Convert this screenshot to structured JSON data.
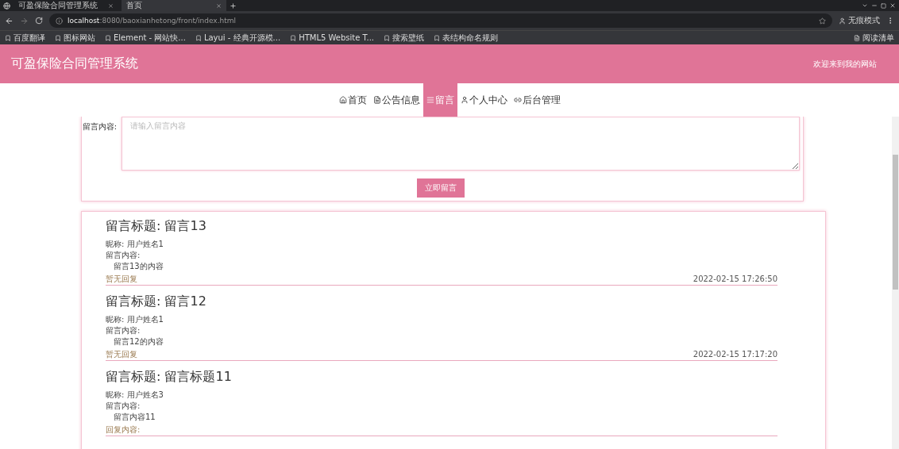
{
  "browser": {
    "tabs": [
      {
        "title": "可盈保险合同管理系统",
        "selected": false
      },
      {
        "title": "首页",
        "selected": true
      }
    ],
    "url_host": "localhost",
    "url_rest": ":8080/baoxianhetong/front/index.html",
    "profile": "无痕模式",
    "bookmarks": [
      "百度翻译",
      "图标网站",
      "Element - 网站快...",
      "Layui - 经典开源模...",
      "HTML5 Website T...",
      "搜索壁纸",
      "表结构命名规则"
    ],
    "reading_list": "阅读清单"
  },
  "header": {
    "title": "可盈保险合同管理系统",
    "welcome": "欢迎来到我的网站"
  },
  "nav": [
    {
      "label": "首页",
      "selected": false
    },
    {
      "label": "公告信息",
      "selected": false
    },
    {
      "label": "留言",
      "selected": true
    },
    {
      "label": "个人中心",
      "selected": false
    },
    {
      "label": "后台管理",
      "selected": false
    }
  ],
  "form": {
    "label": "留言内容:",
    "placeholder": "请输入留言内容",
    "submit": "立即留言"
  },
  "messages": [
    {
      "title_label": "留言标题:",
      "title": "留言13",
      "nickname": "昵称:  用户姓名1",
      "content_label": "留言内容:",
      "content": "留言13的内容",
      "reply": "暂无回复",
      "time": "2022-02-15 17:26:50"
    },
    {
      "title_label": "留言标题:",
      "title": "留言12",
      "nickname": "昵称:  用户姓名1",
      "content_label": "留言内容:",
      "content": "留言12的内容",
      "reply": "暂无回复",
      "time": "2022-02-15 17:17:20"
    },
    {
      "title_label": "留言标题:",
      "title": "留言标题11",
      "nickname": "昵称:  用户姓名3",
      "content_label": "留言内容:",
      "content": "留言内容11",
      "reply": "回复内容:"
    }
  ]
}
